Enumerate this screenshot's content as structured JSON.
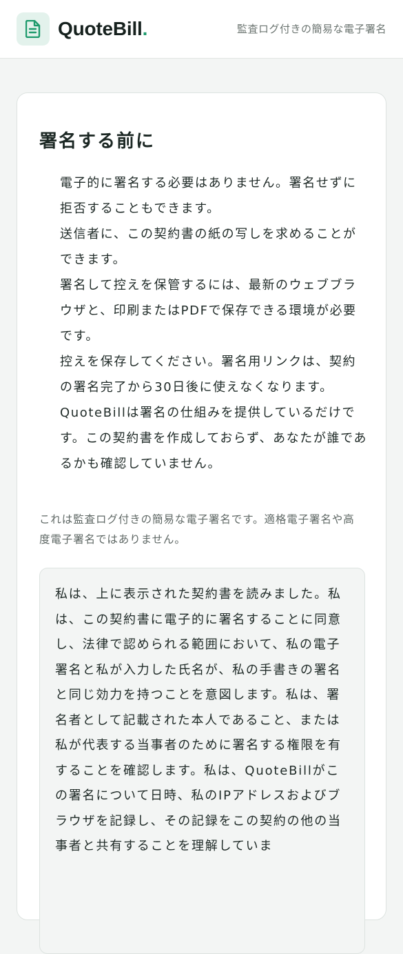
{
  "header": {
    "brand_name": "QuoteBill",
    "brand_dot": ".",
    "tagline": "監査ログ付きの簡易な電子署名",
    "logo_icon": "document-icon",
    "accent_color": "#1d9a6c"
  },
  "notice": {
    "title": "署名する前に",
    "items": [
      "電子的に署名する必要はありません。署名せずに拒否することもできます。",
      "送信者に、この契約書の紙の写しを求めることができます。",
      "署名して控えを保管するには、最新のウェブブラウザと、印刷またはPDFで保存できる環境が必要です。",
      "控えを保存してください。署名用リンクは、契約の署名完了から30日後に使えなくなります。",
      "QuoteBillは署名の仕組みを提供しているだけです。この契約書を作成しておらず、あなたが誰であるかも確認していません。"
    ],
    "disclaimer": "これは監査ログ付きの簡易な電子署名です。適格電子署名や高度電子署名ではありません。"
  },
  "consent": {
    "text": "私は、上に表示された契約書を読みました。私は、この契約書に電子的に署名することに同意し、法律で認められる範囲において、私の電子署名と私が入力した氏名が、私の手書きの署名と同じ効力を持つことを意図します。私は、署名者として記載された本人であること、または私が代表する当事者のために署名する権限を有することを確認します。私は、QuoteBillがこの署名について日時、私のIPアドレスおよびブラウザを記録し、その記録をこの契約の他の当事者と共有することを理解していま"
  }
}
